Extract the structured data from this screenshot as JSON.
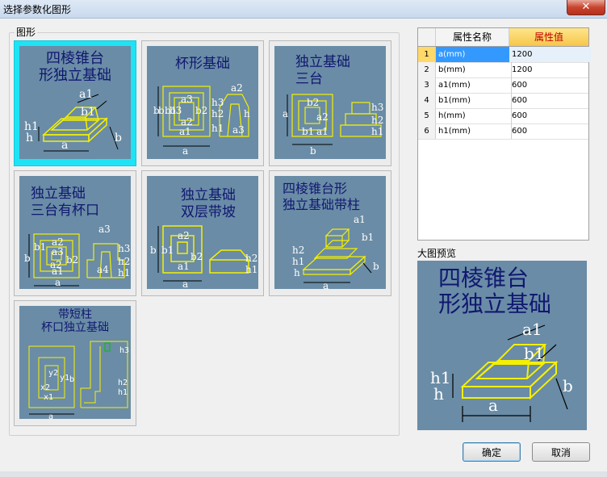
{
  "window": {
    "title": "选择参数化图形",
    "close_label": "✕"
  },
  "group": {
    "label": "图形"
  },
  "shapes": [
    {
      "title_lines": [
        "四棱锥台",
        "形独立基础"
      ],
      "selected": true,
      "dims": [
        "a1",
        "b1",
        "h1",
        "h",
        "a",
        "b"
      ]
    },
    {
      "title_lines": [
        "杯形基础"
      ],
      "selected": false,
      "dims": [
        "a2",
        "a3",
        "b3",
        "b2",
        "b1",
        "a2",
        "a1",
        "h3",
        "h2",
        "h1",
        "b",
        "b",
        "a",
        "h",
        "a3"
      ]
    },
    {
      "title_lines": [
        "独立基础",
        "三台"
      ],
      "selected": false,
      "dims": [
        "a",
        "b2",
        "a2",
        "b1",
        "a1",
        "h3",
        "h2",
        "h1",
        "b"
      ]
    },
    {
      "title_lines": [
        "独立基础",
        "三台有杯口"
      ],
      "selected": false,
      "dims": [
        "a3",
        "a2",
        "a3",
        "a1",
        "b1",
        "b2",
        "a2",
        "b",
        "h3",
        "h2",
        "h1",
        "a4",
        "a"
      ]
    },
    {
      "title_lines": [
        "独立基础",
        "双层带坡"
      ],
      "selected": false,
      "dims": [
        "a2",
        "b2",
        "a1",
        "b",
        "b1",
        "h2",
        "h1",
        "a"
      ]
    },
    {
      "title_lines": [
        "四棱锥台形",
        "独立基础带柱"
      ],
      "selected": false,
      "dims": [
        "a1",
        "b1",
        "h2",
        "h1",
        "h",
        "b",
        "a"
      ]
    },
    {
      "title_lines": [
        "带短柱",
        "杯口独立基础"
      ],
      "selected": false,
      "dims": [
        "x2",
        "y2",
        "x1",
        "y1",
        "b",
        "h3",
        "h1",
        "h2",
        "a"
      ]
    }
  ],
  "properties": {
    "headers": [
      "属性名称",
      "属性值"
    ],
    "rows": [
      {
        "num": "1",
        "name": "a(mm)",
        "value": "1200"
      },
      {
        "num": "2",
        "name": "b(mm)",
        "value": "1200"
      },
      {
        "num": "3",
        "name": "a1(mm)",
        "value": "600"
      },
      {
        "num": "4",
        "name": "b1(mm)",
        "value": "600"
      },
      {
        "num": "5",
        "name": "h(mm)",
        "value": "600"
      },
      {
        "num": "6",
        "name": "h1(mm)",
        "value": "600"
      }
    ]
  },
  "preview": {
    "label": "大图预览",
    "title_lines": [
      "四棱锥台",
      "形独立基础"
    ],
    "dims": [
      "a1",
      "b1",
      "h1",
      "h",
      "a",
      "b"
    ]
  },
  "buttons": {
    "ok": "确定",
    "cancel": "取消"
  },
  "colors": {
    "thumb_bg": "#6a8ca6",
    "line": "#f5f000",
    "selected": "#1ee3f5",
    "title_text": "#101870",
    "header_value_text": "#c00000"
  }
}
